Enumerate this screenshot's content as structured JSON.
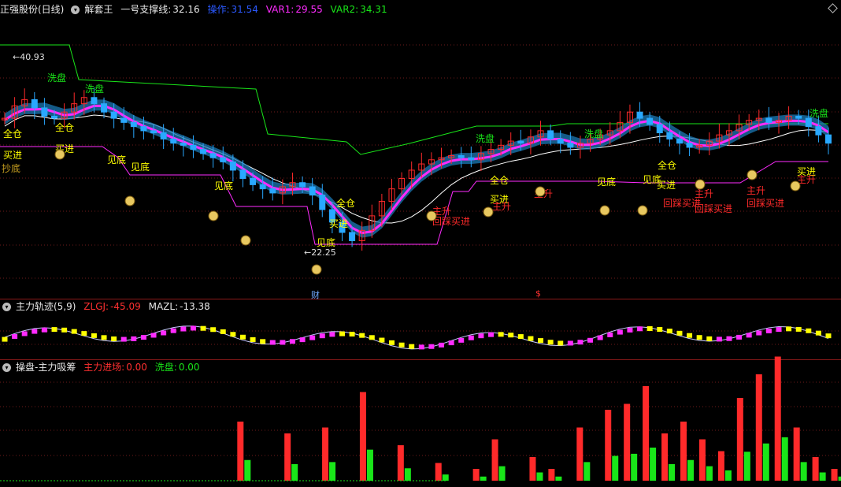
{
  "header": {
    "stock": "正强股份(日线)",
    "indicator_name": "解套王",
    "support_label": "一号支撑线:",
    "support_value": "32.16",
    "op_label": "操作:",
    "op_value": "31.54",
    "var1_label": "VAR1:",
    "var1_value": "29.55",
    "var2_label": "VAR2:",
    "var2_value": "34.31"
  },
  "price_labels": {
    "high": "40.93",
    "low": "22.25"
  },
  "markers": {
    "cai": "财",
    "dollar": "$"
  },
  "signals": {
    "xipan": "洗盘",
    "quancang": "全仓",
    "maijin": "买进",
    "chaodi": "抄底",
    "jiandi": "见底",
    "zhusheng": "主升",
    "huicai": "回踩买进"
  },
  "panel2": {
    "title": "主力轨迹(5,9)",
    "zlgj_label": "ZLGJ:",
    "zlgj_value": "-45.09",
    "mazl_label": "MAZL:",
    "mazl_value": "-13.38"
  },
  "panel3": {
    "title": "操盘-主力吸筹",
    "zljc_label": "主力进场:",
    "zljc_value": "0.00",
    "xp_label": "洗盘:",
    "xp_value": "0.00"
  },
  "colors": {
    "up": "#ff2a2a",
    "down": "#29a8ff",
    "magenta": "#ff2bff",
    "yellow": "#ffff00",
    "green": "#19e619",
    "white": "#ffffff",
    "band": "#1b78b4",
    "grid": "#6e1a1a"
  },
  "chart_data": {
    "type": "candlestick",
    "price_range": [
      22.25,
      40.93
    ],
    "close_series_approx": [
      35.0,
      36.2,
      36.8,
      36.0,
      35.2,
      35.0,
      35.6,
      36.4,
      37.0,
      36.4,
      35.6,
      35.0,
      34.6,
      34.2,
      33.8,
      33.6,
      33.0,
      32.6,
      32.4,
      32.0,
      31.6,
      31.2,
      30.8,
      30.0,
      29.2,
      28.6,
      28.2,
      27.8,
      28.4,
      28.8,
      28.4,
      27.6,
      26.2,
      25.0,
      24.0,
      23.2,
      24.2,
      25.6,
      27.0,
      28.2,
      29.2,
      30.0,
      30.6,
      31.0,
      31.2,
      31.4,
      31.2,
      31.0,
      31.6,
      32.0,
      32.4,
      32.8,
      32.6,
      33.2,
      33.8,
      33.0,
      32.6,
      32.2,
      32.6,
      33.0,
      33.4,
      33.8,
      34.6,
      35.6,
      35.0,
      34.4,
      33.6,
      33.0,
      32.6,
      32.2,
      32.4,
      32.8,
      33.4,
      33.8,
      34.4,
      34.8,
      35.0,
      34.6,
      34.8,
      35.2,
      35.0,
      34.2,
      33.4,
      32.6
    ],
    "zlgj_min": -45.09,
    "mazl": -13.38,
    "accumulation_bars": [
      [
        25,
        10
      ],
      [
        30,
        8
      ],
      [
        34,
        9
      ],
      [
        38,
        15
      ],
      [
        42,
        6
      ],
      [
        46,
        3
      ],
      [
        50,
        2
      ],
      [
        52,
        7
      ],
      [
        56,
        4
      ],
      [
        58,
        2
      ],
      [
        61,
        9
      ],
      [
        64,
        12
      ],
      [
        66,
        13
      ],
      [
        68,
        16
      ],
      [
        70,
        8
      ],
      [
        72,
        10
      ],
      [
        74,
        7
      ],
      [
        76,
        5
      ],
      [
        78,
        14
      ],
      [
        80,
        18
      ],
      [
        82,
        21
      ],
      [
        84,
        9
      ],
      [
        86,
        4
      ],
      [
        88,
        2
      ]
    ]
  }
}
